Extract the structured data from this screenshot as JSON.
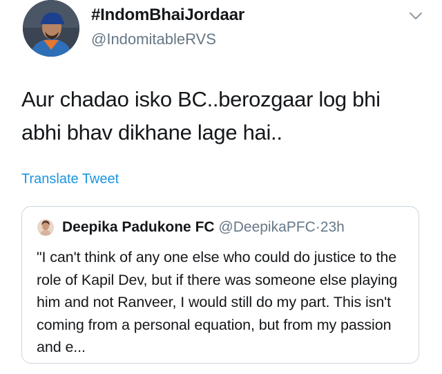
{
  "author": {
    "display_name": "#IndomBhaiJordaar",
    "handle": "@IndomitableRVS",
    "avatar_icon": "profile-photo"
  },
  "tweet": {
    "text": "Aur chadao isko BC..berozgaar log bhi abhi bhav dikhane lage hai..",
    "translate_label": "Translate Tweet"
  },
  "quoted_tweet": {
    "display_name": "Deepika Padukone FC",
    "handle": "@DeepikaPFC",
    "separator": "·",
    "time": "23h",
    "text": "\"I can't think of any one else who could do justice to the role of Kapil Dev, but if there was someone else playing him and not Ranveer, I would still do my part. This isn't coming from a personal equation, but from my passion and e..."
  },
  "colors": {
    "link": "#1b95e0",
    "secondary_text": "#657786",
    "border": "#ccd6dd"
  }
}
